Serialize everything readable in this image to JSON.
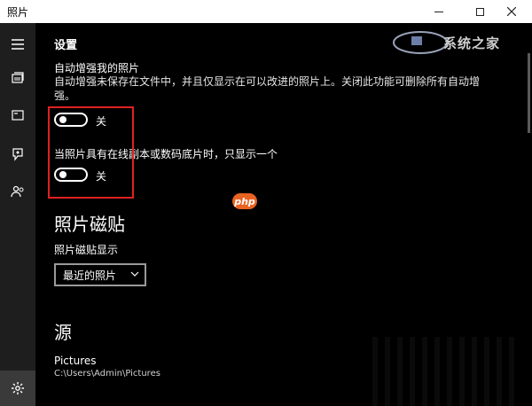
{
  "window": {
    "title": "照片",
    "controls": {
      "minimize": "—",
      "maximize": "☐",
      "close": "✕"
    }
  },
  "rail": {
    "items": [
      {
        "icon": "hamburger-menu-icon"
      },
      {
        "icon": "collection-icon"
      },
      {
        "icon": "albums-icon"
      },
      {
        "icon": "story-remix-icon"
      },
      {
        "icon": "people-icon"
      },
      {
        "icon": "settings-gear-icon"
      }
    ]
  },
  "header": {
    "title": "设置"
  },
  "watermark": {
    "text": "系统之家"
  },
  "settings": {
    "auto_enhance": {
      "label": "自动增强我的照片",
      "description": "自动增强未保存在文件中，并且仅显示在可以改进的照片上。关闭此功能可删除所有自动增强。",
      "toggle_state": "关"
    },
    "linked_duplicates": {
      "label": "当照片具有在线副本或数码底片时，只显示一个",
      "toggle_state": "关"
    }
  },
  "tiles": {
    "heading": "照片磁贴",
    "sub_label": "照片磁贴显示",
    "dropdown_value": "最近的照片"
  },
  "sources": {
    "heading": "源",
    "folder_name": "Pictures",
    "folder_path": "C:\\Users\\Admin\\Pictures"
  },
  "badge": {
    "text": "php"
  },
  "colors": {
    "highlight": "#e02020",
    "badge": "#e96322",
    "rail_bg": "#1e1e1e"
  }
}
